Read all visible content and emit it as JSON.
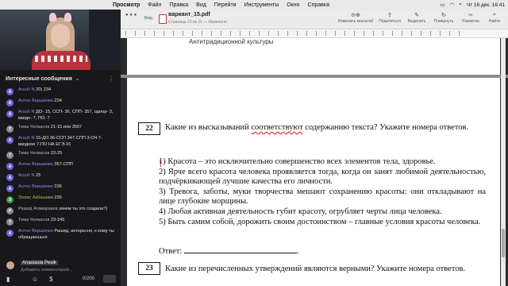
{
  "menubar": {
    "app": "Просмотр",
    "items": [
      "Файл",
      "Правка",
      "Вид",
      "Перейти",
      "Инструменты",
      "Окно",
      "Справка"
    ],
    "clock": "Чт 16 дек. 16:41"
  },
  "chat": {
    "header_title": "Интересные сообщения",
    "messages": [
      {
        "name": "Aruuh N",
        "text": "20) 234",
        "color": "#6c62e0",
        "initial": "A",
        "style": "purple"
      },
      {
        "name": "Антон Вершинин",
        "text": "234",
        "color": "#6c62e0",
        "initial": "А",
        "style": "purple"
      },
      {
        "name": "Aruuh N",
        "text": "ДО- 15, ССП- 36, СПП- 357, однор- 3, вводн- 7, ПО- 7",
        "color": "#6c62e0",
        "initial": "A",
        "style": "purple"
      },
      {
        "name": "Тима Челкасов",
        "text": "21-15 или 3567",
        "color": "#8a8a93",
        "initial": "Т",
        "style": "grey"
      },
      {
        "name": "Aruuh N",
        "text": "15-ДО 36-ССП 347-СПП 3-ОЧ 7-вводное 7-ПО НА ЕГЭ-15",
        "color": "#6c62e0",
        "initial": "A",
        "style": "purple"
      },
      {
        "name": "Тима Челкасов",
        "text": "22-25",
        "color": "#8a8a93",
        "initial": "Т",
        "style": "grey"
      },
      {
        "name": "Антон Вершинин",
        "text": "357-СПП",
        "color": "#6c62e0",
        "initial": "А",
        "style": "purple"
      },
      {
        "name": "Aruuh N",
        "text": "25",
        "color": "#6c62e0",
        "initial": "A",
        "style": "purple"
      },
      {
        "name": "Антон Вершинин",
        "text": "235",
        "color": "#6c62e0",
        "initial": "А",
        "style": "purple"
      },
      {
        "name": "Эллис Акбашева",
        "text": "235",
        "color": "#3b9b5a",
        "initial": "Э",
        "style": "green"
      },
      {
        "name": "Рашид Агамирзаев",
        "text": "зачем ты это создала?)",
        "color": "#8a8a93",
        "initial": "Р",
        "style": "grey"
      },
      {
        "name": "Тима Челкасов",
        "text": "23-245",
        "color": "#8a8a93",
        "initial": "Т",
        "style": "grey"
      },
      {
        "name": "Антон Вершинин",
        "text": "Рашид, интересно, к кому ты обращаешься",
        "color": "#6c62e0",
        "initial": "А",
        "style": "purple"
      }
    ],
    "self_name": "Anastasia Pesik",
    "input_placeholder": "Добавить комментарий...",
    "counter": "0/200"
  },
  "viewer": {
    "traffic_lights": "● ● ●",
    "view_label": "Вид",
    "filename": "вариант_15.pdf",
    "subtitle": "Страница 10 из 11 — Изменено",
    "tools": [
      "Изменить масштаб",
      "Поделиться",
      "Выделить",
      "Повернуть",
      "Разметка",
      "Найти"
    ],
    "top_cut_text": "Антитрадиционной культуры"
  },
  "page": {
    "q22": {
      "number": "22",
      "prompt_before": "Какие из высказываний ",
      "prompt_highlight": "соответствуют",
      "prompt_after": " содержанию текста? Укажите номера ответов.",
      "options": [
        "1) Красота – это исключительно совершенство всех элементов тела, здоровье.",
        "2) Ярче всего красота человека проявляется тогда, когда он занят любимой деятельностью, подчёркивающей лучшие качества его личности.",
        "3) Тревога, заботы, муки творчества мешают сохранению красоты: они откладывают на лице глубокие морщины.",
        "4) Любая активная деятельность губит красоту, огрубляет черты лица человека.",
        "5) Быть самим собой, дорожить своим достоинством – главные условия красоты человека."
      ],
      "answer_label": "Ответ:"
    },
    "q23": {
      "number": "23",
      "prompt": "Какие из перечисленных утверждений являются верными? Укажите номера ответов."
    }
  },
  "colors": {
    "accent_purple": "#8f8cf2",
    "chat_bg": "#18181b",
    "annotation_red": "#d22233"
  }
}
